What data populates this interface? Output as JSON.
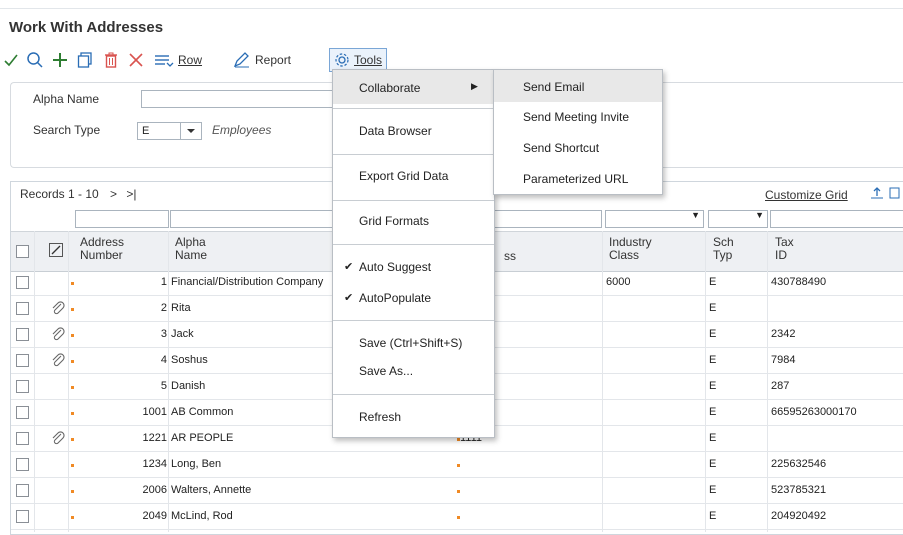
{
  "page": {
    "title": "Work With Addresses"
  },
  "toolbar": {
    "row_label": "Row",
    "report_label": "Report",
    "tools_label": "Tools"
  },
  "filters": {
    "alpha_name_label": "Alpha Name",
    "alpha_name_value": "",
    "search_type_label": "Search Type",
    "search_type_value": "E",
    "search_type_desc": "Employees"
  },
  "grid": {
    "records_label": "Records 1 - 10",
    "customize_label": "Customize Grid",
    "headers": {
      "address_number": [
        "Address",
        "Number"
      ],
      "alpha_name": [
        "Alpha",
        "Name"
      ],
      "address": "ss",
      "industry_class": [
        "Industry",
        "Class"
      ],
      "sch_typ": [
        "Sch",
        "Typ"
      ],
      "tax_id": [
        "Tax",
        "ID"
      ]
    },
    "rows": [
      {
        "num": "1",
        "name": "Financial/Distribution Company",
        "addr": "",
        "industry": "6000",
        "sch": "E",
        "tax": "430788490",
        "attach": false,
        "addr_marker": false
      },
      {
        "num": "2",
        "name": "Rita",
        "addr": "",
        "industry": "",
        "sch": "E",
        "tax": "",
        "attach": true,
        "addr_marker": false
      },
      {
        "num": "3",
        "name": "Jack",
        "addr": "",
        "industry": "",
        "sch": "E",
        "tax": "2342",
        "attach": true,
        "addr_marker": false
      },
      {
        "num": "4",
        "name": "Soshus",
        "addr": "",
        "industry": "",
        "sch": "E",
        "tax": "7984",
        "attach": true,
        "addr_marker": false
      },
      {
        "num": "5",
        "name": "Danish",
        "addr": "",
        "industry": "",
        "sch": "E",
        "tax": "287",
        "attach": false,
        "addr_marker": false
      },
      {
        "num": "1001",
        "name": "AB Common",
        "addr": "",
        "industry": "",
        "sch": "E",
        "tax": "66595263000170",
        "attach": false,
        "addr_marker": false
      },
      {
        "num": "1221",
        "name": "AR PEOPLE",
        "addr": "1111",
        "industry": "",
        "sch": "E",
        "tax": "",
        "attach": true,
        "addr_marker": true
      },
      {
        "num": "1234",
        "name": "Long, Ben",
        "addr": "",
        "industry": "",
        "sch": "E",
        "tax": "225632546",
        "attach": false,
        "addr_marker": true
      },
      {
        "num": "2006",
        "name": "Walters, Annette",
        "addr": "",
        "industry": "",
        "sch": "E",
        "tax": "523785321",
        "attach": false,
        "addr_marker": true
      },
      {
        "num": "2049",
        "name": "McLind, Rod",
        "addr": "",
        "industry": "",
        "sch": "E",
        "tax": "204920492",
        "attach": false,
        "addr_marker": true
      }
    ]
  },
  "tools_menu": {
    "collaborate": "Collaborate",
    "data_browser": "Data Browser",
    "export_grid": "Export Grid Data",
    "grid_formats": "Grid Formats",
    "auto_suggest": "Auto Suggest",
    "auto_populate": "AutoPopulate",
    "save": "Save (Ctrl+Shift+S)",
    "save_as": "Save As...",
    "refresh": "Refresh"
  },
  "collab_menu": {
    "send_email": "Send Email",
    "send_meeting": "Send Meeting Invite",
    "send_shortcut": "Send Shortcut",
    "param_url": "Parameterized URL"
  },
  "colors": {
    "accent": "#2e7d32",
    "orange": "#f08a24",
    "delete": "#d9534f",
    "highlight": "#e8e8e8"
  }
}
